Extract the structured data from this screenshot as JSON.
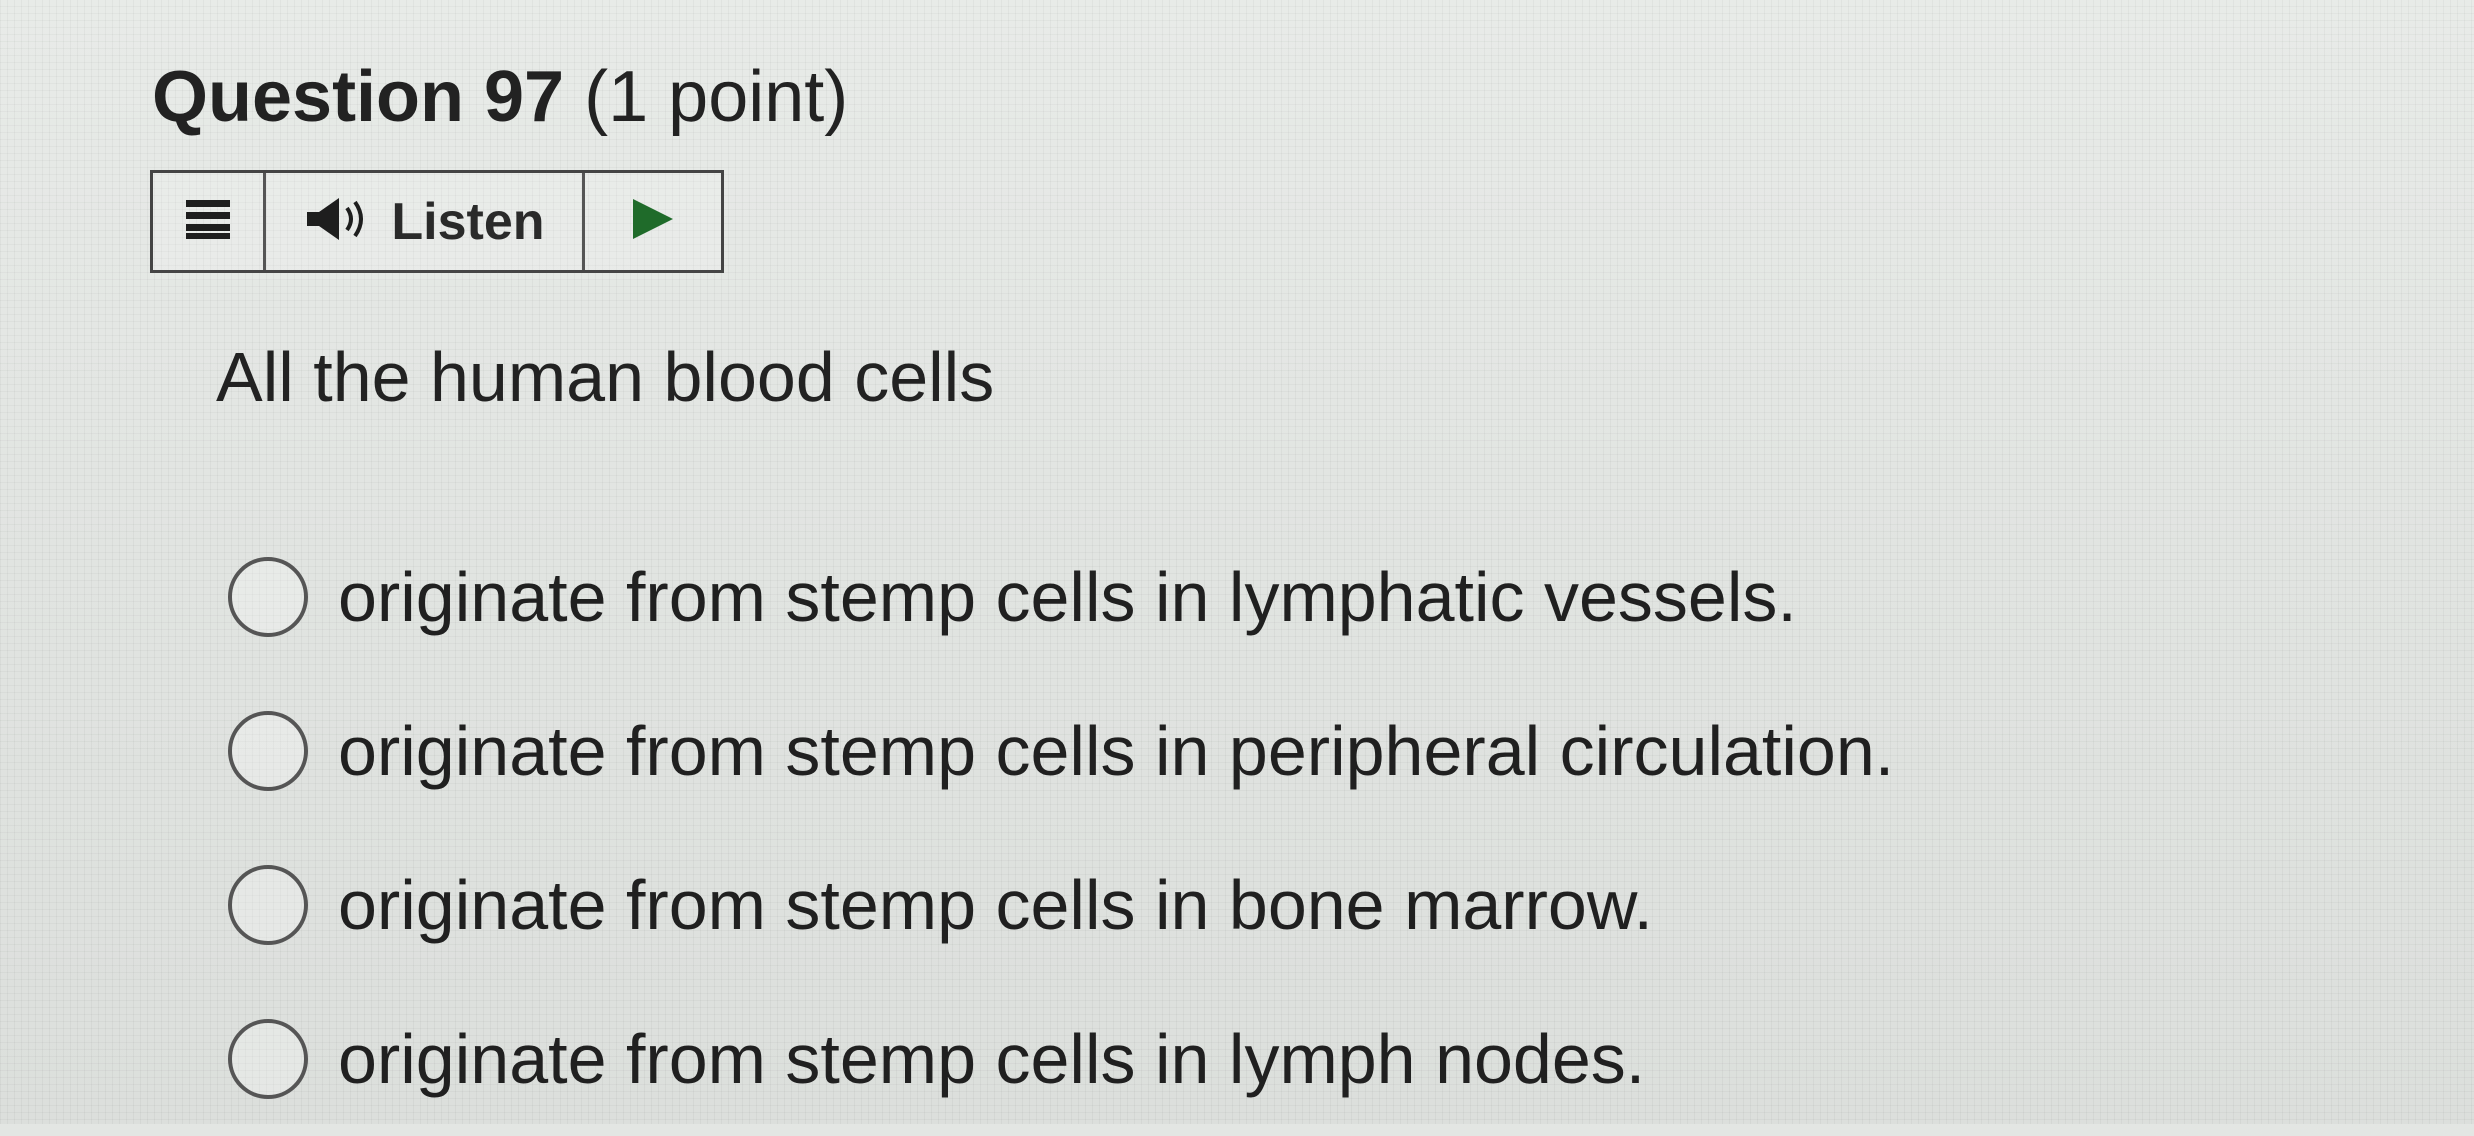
{
  "question": {
    "number_label": "Question 97",
    "points_label": "(1 point)",
    "stem": "All the human blood cells"
  },
  "toolbar": {
    "menu_icon": "hamburger-menu-icon",
    "speaker_icon": "speaker-icon",
    "listen_label": "Listen",
    "play_icon": "play-icon"
  },
  "options": [
    {
      "label": "originate from stemp cells in lymphatic vessels.",
      "selected": false
    },
    {
      "label": "originate from stemp cells in peripheral circulation.",
      "selected": false
    },
    {
      "label": "originate from stemp cells in bone marrow.",
      "selected": false
    },
    {
      "label": "originate from stemp cells in lymph nodes.",
      "selected": false
    }
  ],
  "colors": {
    "play_accent": "#1f6b2a",
    "text": "#222222",
    "border": "#444444"
  }
}
